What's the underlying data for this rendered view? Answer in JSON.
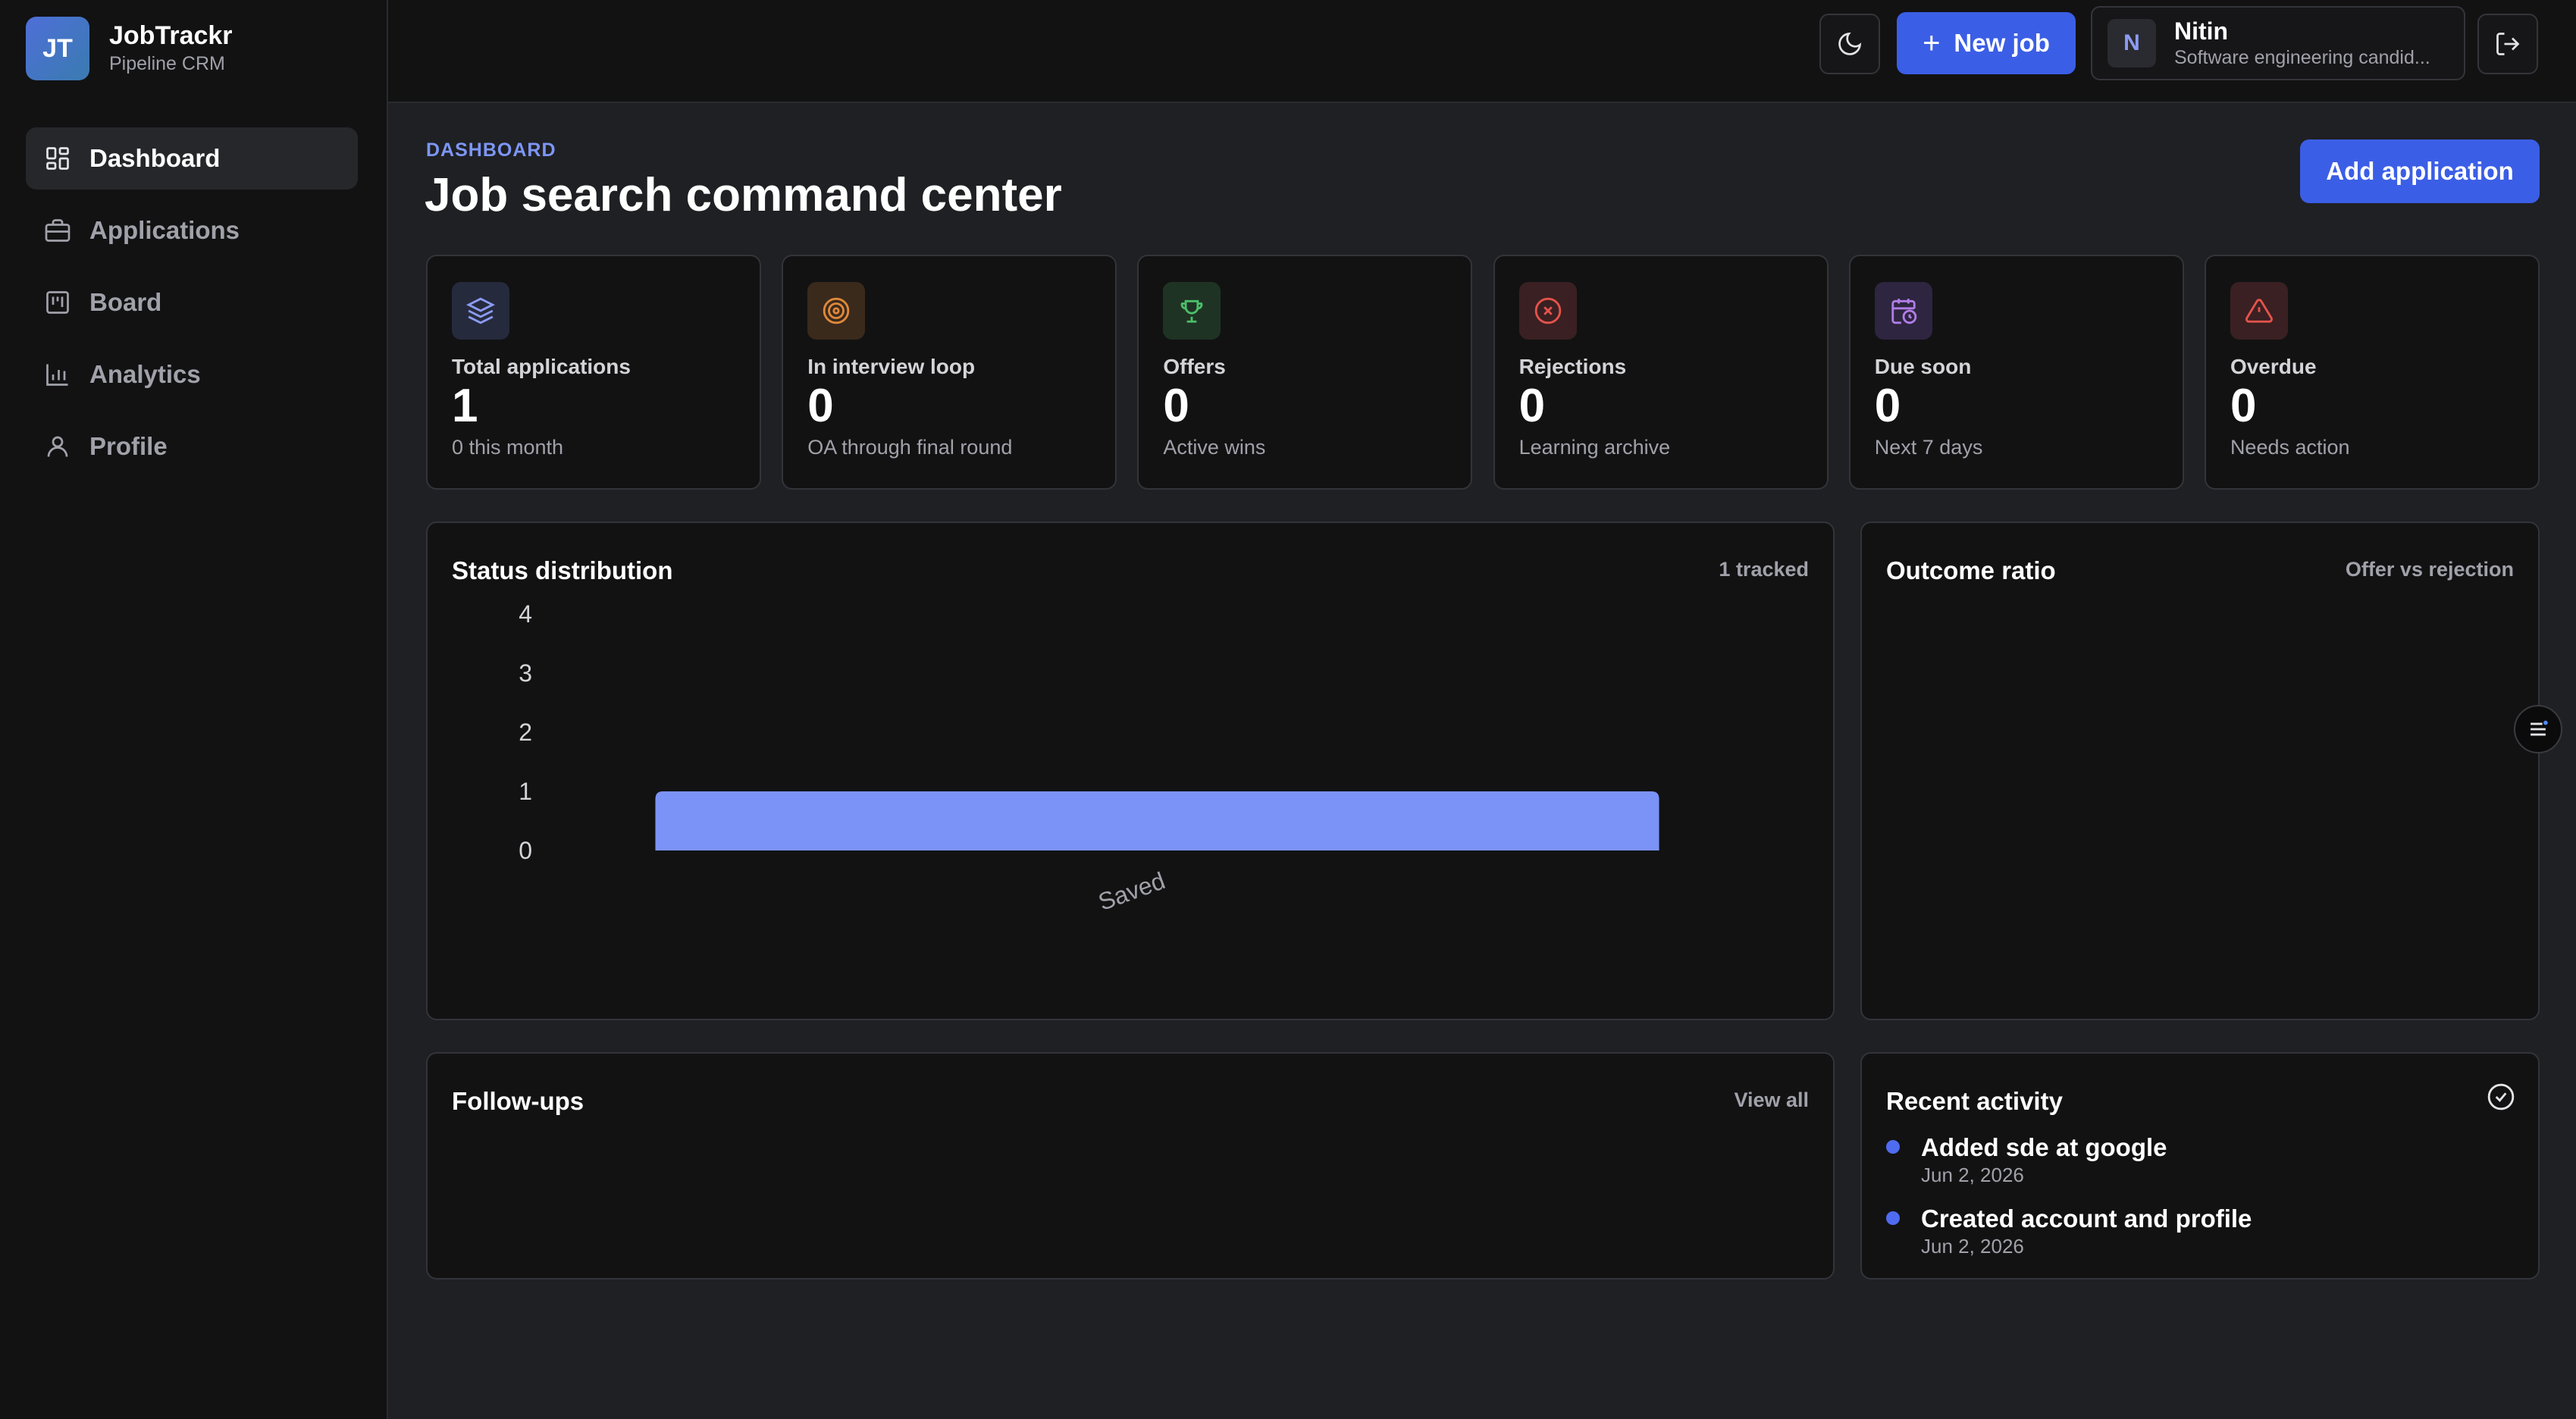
{
  "brand": {
    "initials": "JT",
    "name": "JobTrackr",
    "subtitle": "Pipeline CRM"
  },
  "nav": [
    {
      "label": "Dashboard",
      "icon": "grid-icon",
      "active": true
    },
    {
      "label": "Applications",
      "icon": "briefcase-icon",
      "active": false
    },
    {
      "label": "Board",
      "icon": "kanban-icon",
      "active": false
    },
    {
      "label": "Analytics",
      "icon": "bar-chart-icon",
      "active": false
    },
    {
      "label": "Profile",
      "icon": "user-icon",
      "active": false
    }
  ],
  "topbar": {
    "new_job_label": "New job",
    "user": {
      "initial": "N",
      "name": "Nitin",
      "role": "Software engineering candid..."
    }
  },
  "header": {
    "eyebrow": "DASHBOARD",
    "title": "Job search command center",
    "add_application_label": "Add application"
  },
  "stats": [
    {
      "label": "Total applications",
      "value": "1",
      "sub": "0 this month",
      "icon": "layers-icon",
      "color": "#8b9cf3",
      "bg": "#262a3d"
    },
    {
      "label": "In interview loop",
      "value": "0",
      "sub": "OA through final round",
      "icon": "target-icon",
      "color": "#e0893a",
      "bg": "#3a2a1c"
    },
    {
      "label": "Offers",
      "value": "0",
      "sub": "Active wins",
      "icon": "trophy-icon",
      "color": "#4cbf6a",
      "bg": "#1f3324"
    },
    {
      "label": "Rejections",
      "value": "0",
      "sub": "Learning archive",
      "icon": "x-circle-icon",
      "color": "#e5534b",
      "bg": "#3a2022"
    },
    {
      "label": "Due soon",
      "value": "0",
      "sub": "Next 7 days",
      "icon": "calendar-clock-icon",
      "color": "#b07de8",
      "bg": "#2e2540"
    },
    {
      "label": "Overdue",
      "value": "0",
      "sub": "Needs action",
      "icon": "alert-triangle-icon",
      "color": "#e5534b",
      "bg": "#3a2022"
    }
  ],
  "status_panel": {
    "title": "Status distribution",
    "meta": "1 tracked"
  },
  "outcome_panel": {
    "title": "Outcome ratio",
    "meta": "Offer vs rejection"
  },
  "followups_panel": {
    "title": "Follow-ups",
    "meta": "View all"
  },
  "activity_panel": {
    "title": "Recent activity",
    "items": [
      {
        "text": "Added sde at google",
        "date": "Jun 2, 2026"
      },
      {
        "text": "Created account and profile",
        "date": "Jun 2, 2026"
      }
    ]
  },
  "colors": {
    "accent": "#3b5ee6",
    "bar": "#7b93f7"
  },
  "chart_data": {
    "type": "bar",
    "categories": [
      "Saved"
    ],
    "values": [
      1
    ],
    "yticks": [
      "0",
      "1",
      "2",
      "3",
      "4"
    ],
    "ylim": [
      0,
      4
    ]
  }
}
